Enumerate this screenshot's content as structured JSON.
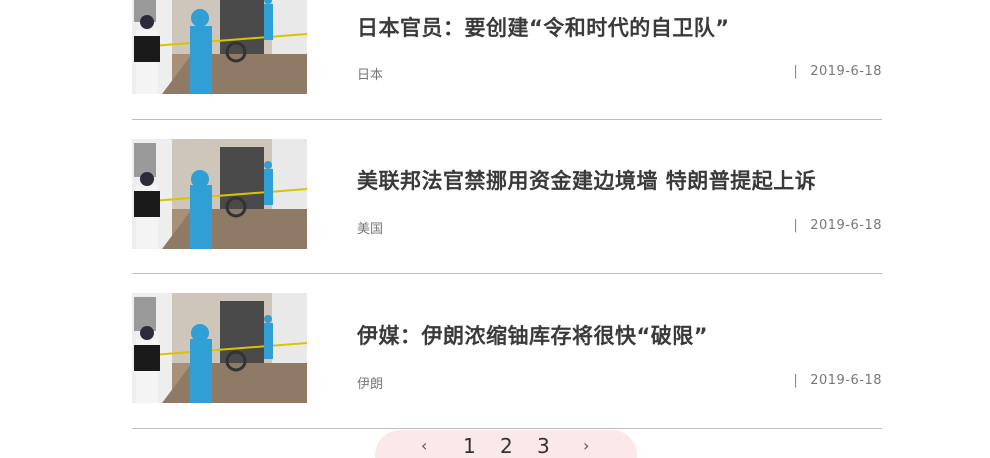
{
  "news_list": [
    {
      "title": "日本官员：要创建“令和时代的自卫队”",
      "category": "日本",
      "date": "2019-6-18",
      "thumbnail_icon": "crime-scene-photo-icon"
    },
    {
      "title": "美联邦法官禁挪用资金建边境墙 特朗普提起上诉",
      "category": "美国",
      "date": "2019-6-18",
      "thumbnail_icon": "crime-scene-photo-icon"
    },
    {
      "title": "伊媒：伊朗浓缩铀库存将很快“破限”",
      "category": "伊朗",
      "date": "2019-6-18",
      "thumbnail_icon": "crime-scene-photo-icon"
    }
  ],
  "date_separator": "|",
  "pagination": {
    "prev": "‹",
    "pages": [
      "1",
      "2",
      "3"
    ],
    "next": "›"
  },
  "colors": {
    "title": "#3a3a3a",
    "meta": "#777777",
    "divider": "#bdbdbd",
    "pager_bg": "#fbe9ea"
  }
}
